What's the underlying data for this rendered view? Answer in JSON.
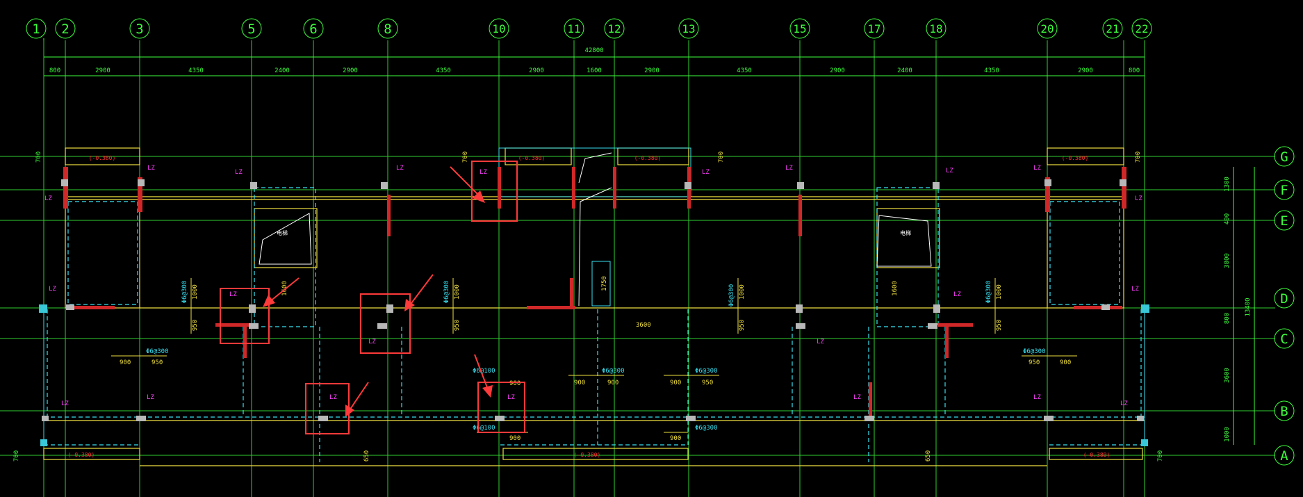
{
  "drawing": {
    "top_axes": [
      "1",
      "2",
      "3",
      "5",
      "6",
      "8",
      "10",
      "11",
      "12",
      "13",
      "15",
      "17",
      "18",
      "20",
      "21",
      "22"
    ],
    "right_axes": [
      "G",
      "F",
      "E",
      "D",
      "C",
      "B",
      "A"
    ],
    "overall_dim": "42800",
    "top_dims": [
      "800",
      "2900",
      "4350",
      "2400",
      "2900",
      "4350",
      "2900",
      "1600",
      "2900",
      "4350",
      "2900",
      "2400",
      "4350",
      "2900",
      "800"
    ],
    "right_dims": [
      "1300",
      "400",
      "3800",
      "800",
      "3600",
      "1000"
    ],
    "right_total": "13400",
    "left_dim_g": "700",
    "left_dim_a": "700",
    "right_dim_a": "700",
    "elev": "(-0.380)",
    "lz": "LZ",
    "rebar": "Φ6@300",
    "rebar2": "Φ6@100",
    "d900": "900",
    "d950": "950",
    "d1000": "1000",
    "d1600": "1600",
    "d1750": "1750",
    "d3600": "3600",
    "d650": "650",
    "d700": "700",
    "shaft": "电梯"
  },
  "colors": {
    "grid": "#3cff3c",
    "wall_yellow": "#f0e040",
    "beam_cyan": "#38e0f0",
    "column_red": "#ff3030",
    "tag_magenta": "#ff40ff",
    "highlight": "#ff3a3a"
  }
}
